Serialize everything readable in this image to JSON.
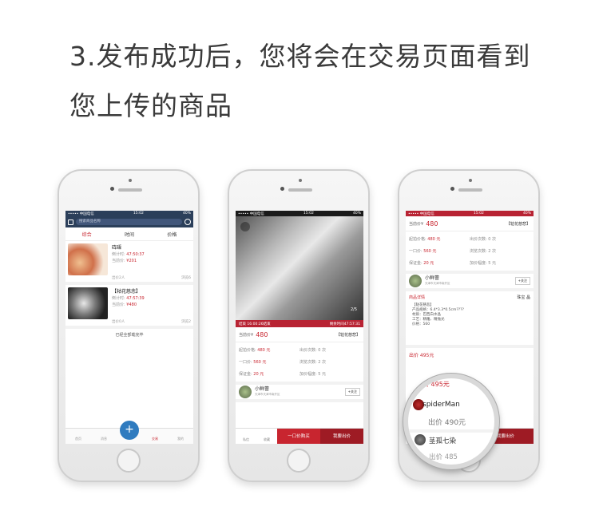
{
  "heading": {
    "line1": "3.发布成功后，您将会在交易页面看到",
    "line2": "您上传的商品"
  },
  "status": {
    "carrier": "••••• 中国电信",
    "time": "15:02",
    "battery": "40%"
  },
  "list": {
    "search_placeholder": "搜索商品名称",
    "tabs": [
      "综合",
      "时间",
      "价格"
    ],
    "items": [
      {
        "title": "砗磲",
        "k1": "倒计时:",
        "v1": "47:50:37",
        "k2": "当前价:",
        "v2": "¥201",
        "bids": "出价2人",
        "views": "浏览6"
      },
      {
        "title": "【轱花慈悲】",
        "k1": "倒计时:",
        "v1": "47:57:39",
        "k2": "当前价:",
        "v2": "¥480",
        "bids": "出价0人",
        "views": "浏览2"
      }
    ],
    "end_text": "已经全部载完毕",
    "tabbar": [
      "首页",
      "消息",
      "",
      "交易",
      "我的"
    ],
    "plus": "+"
  },
  "detail": {
    "photo_counter": "2/5",
    "auction_end": "结束 16:00:26结束",
    "countdown": "剩余时间47:57:31",
    "price_label": "当前价¥",
    "price": "480",
    "name": "【轱花慈悲】",
    "fields": [
      {
        "k": "起拍价格:",
        "v": "480 元",
        "red": true
      },
      {
        "k": "出价次数:",
        "v": "0 次",
        "red": false
      },
      {
        "k": "一口价:",
        "v": "560 元",
        "red": true
      },
      {
        "k": "浏览次数:",
        "v": "2 次",
        "red": false
      },
      {
        "k": "保证金:",
        "v": "20 元",
        "red": true
      },
      {
        "k": "加价幅度:",
        "v": "5 元",
        "red": false
      }
    ],
    "seller": "小鲜蕾",
    "seller_loc": "天津市天津市南开区",
    "follow": "+关注",
    "actions": {
      "chat": "私信",
      "fav": "收藏",
      "buynow": "一口价购买",
      "bid": "我要出价"
    }
  },
  "detail2": {
    "section": "商品详情",
    "category": "珠宝  晶",
    "desc_lines": [
      "【轱花慈悲】",
      "产品规格：6.4*3.3*0.5cm????",
      "材质：巴西白水晶",
      "工艺：精雕、精抛光",
      "价格：560"
    ],
    "bid_header": "出价 495元"
  },
  "magnifier": {
    "top": "出价 495元",
    "bidder1": "spiderMan",
    "bid1": "出价 490元",
    "bidder2": "茎孤七染",
    "bid2": "出价 485"
  }
}
